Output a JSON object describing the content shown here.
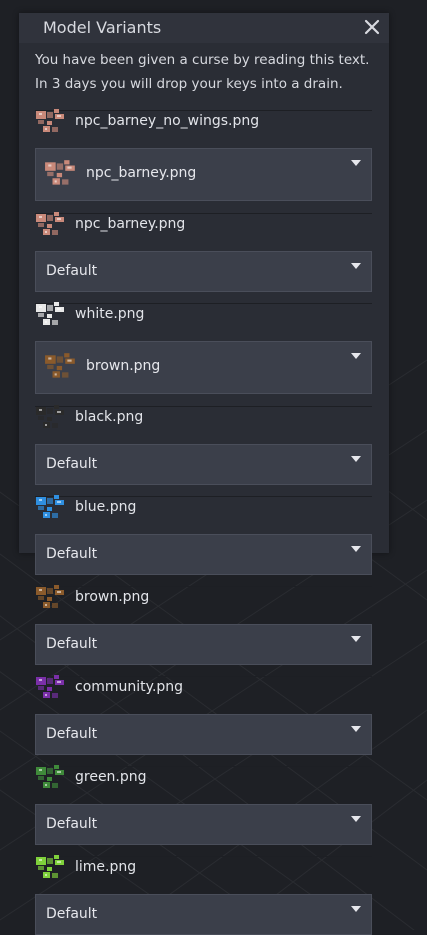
{
  "dialog": {
    "title": "Model Variants",
    "message": "You have been given a curse by reading this text. In 3 days you will drop your keys into a drain."
  },
  "variants": [
    {
      "name": "npc_barney_no_wings.png",
      "selected": "npc_barney.png",
      "thumb_color": "#c9897a",
      "selected_thumb_color": "#c9897a"
    },
    {
      "name": "npc_barney.png",
      "selected": "Default",
      "thumb_color": "#c9897a"
    },
    {
      "name": "white.png",
      "selected": "brown.png",
      "thumb_color": "#e8e8e8",
      "selected_thumb_color": "#8a5a2b"
    },
    {
      "name": "black.png",
      "selected": "Default",
      "thumb_color": "#2a2a2a"
    },
    {
      "name": "blue.png",
      "selected": "Default",
      "thumb_color": "#2f8fe0"
    },
    {
      "name": "brown.png",
      "selected": "Default",
      "thumb_color": "#8a5a2b"
    },
    {
      "name": "community.png",
      "selected": "Default",
      "thumb_color": "#7a2fa8"
    },
    {
      "name": "green.png",
      "selected": "Default",
      "thumb_color": "#3f8a3a"
    },
    {
      "name": "lime.png",
      "selected": "Default",
      "thumb_color": "#7fd13b"
    }
  ],
  "icons": {
    "close": "close-icon",
    "dropdown": "caret-down-icon",
    "thumbnail": "texture-thumbnail-icon"
  },
  "colors": {
    "dialog_bg": "#2a2d35",
    "select_bg": "#3b3f4a",
    "page_bg": "#1e2025"
  }
}
